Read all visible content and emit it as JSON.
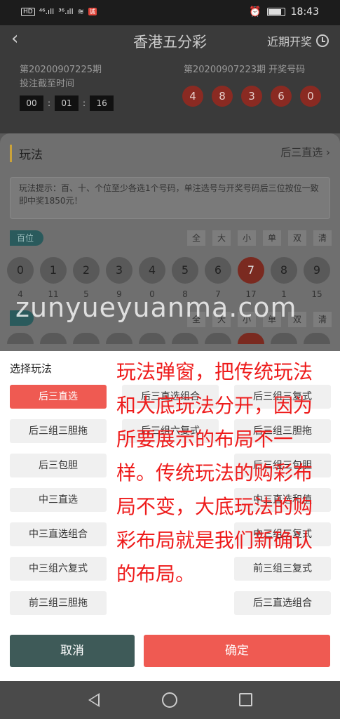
{
  "status_bar": {
    "hd": "HD",
    "signal1": "⁴⁶.ıll",
    "signal2": "³⁶.ıll",
    "badge": "诚",
    "alarm": "⏰",
    "time": "18:43"
  },
  "header": {
    "back": "‹",
    "title": "香港五分彩",
    "recent_label": "近期开奖"
  },
  "draw": {
    "current_issue": "第20200907225期",
    "deadline_label": "投注截至时间",
    "countdown": [
      "00",
      "01",
      "16"
    ],
    "separator": ":",
    "previous_issue": "第20200907223期 开奖号码",
    "previous_numbers": [
      "4",
      "8",
      "3",
      "6",
      "0"
    ]
  },
  "sheet": {
    "title": "玩法",
    "mode": "后三直选",
    "mode_chevron": "›",
    "tip": "玩法提示：百、十、个位至少各选1个号码，单注选号与开奖号码后三位按位一致即中奖1850元！",
    "digit_tag": "百位",
    "quick_buttons": [
      "全",
      "大",
      "小",
      "单",
      "双",
      "清"
    ],
    "balls": [
      "0",
      "1",
      "2",
      "3",
      "4",
      "5",
      "6",
      "7",
      "8",
      "9"
    ],
    "selected_ball": "7",
    "counts": [
      "4",
      "11",
      "5",
      "9",
      "0",
      "8",
      "7",
      "17",
      "1",
      "15"
    ]
  },
  "watermark": "zunyueyuanma.com",
  "modal": {
    "title": "选择玩法",
    "options_left": [
      "后三直选",
      "后三组三胆拖",
      "后三包胆",
      "中三直选",
      "中三直选组合",
      "中三组六复式",
      "前三组三胆拖"
    ],
    "options_right": [
      "后三直选组合",
      "后三组三复式",
      "后三组三胆拖",
      "后三组三包胆",
      "中三直选和值",
      "中三组三复式",
      "前三组三复式"
    ],
    "hidden_right_visible_fragments": [
      "后三直选组合",
      "后三组六复式"
    ],
    "active_option": "后三直选",
    "annotation": "玩法弹窗，把传统玩法和大底玩法分开，因为所要展示的布局不一样。传统玩法的购彩布局不变，大底玩法的购彩布局就是我们新确认的布局。",
    "cancel_label": "取消",
    "confirm_label": "确定"
  },
  "colors": {
    "accent": "#ef5a52",
    "cancel": "#3e5a58",
    "annotation": "#ee1c1c"
  },
  "nav_bar": {
    "icons": [
      "back-triangle-icon",
      "home-circle-icon",
      "recent-square-icon"
    ]
  }
}
